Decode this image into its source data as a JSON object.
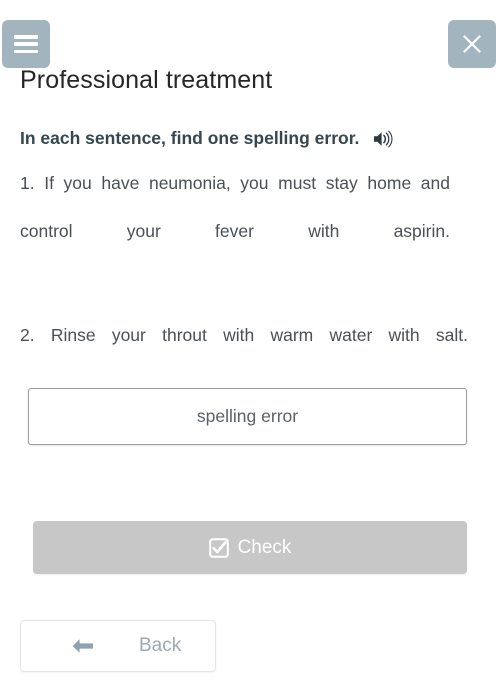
{
  "header": {
    "menu_icon": "hamburger-menu-icon",
    "close_icon": "close-x-icon",
    "button_color": "#a2b4bd"
  },
  "page_title": "Professional treatment",
  "exercise": {
    "instruction": "In each sentence, find one spelling error.",
    "audio_icon": "speaker-sound-icon",
    "sentences": [
      "1. If you have neumonia, you must stay home and control your fever with aspirin.",
      "2. Rinse your throut with warm water with salt."
    ]
  },
  "answer": {
    "value": "spelling error",
    "placeholder": "spelling error",
    "accent_color": "#b4c72b"
  },
  "actions": {
    "check_label": "Check",
    "check_icon": "checkbox-checked-icon",
    "check_color": "#c7c7c7",
    "back_label": "Back",
    "back_icon": "arrow-left-icon"
  }
}
